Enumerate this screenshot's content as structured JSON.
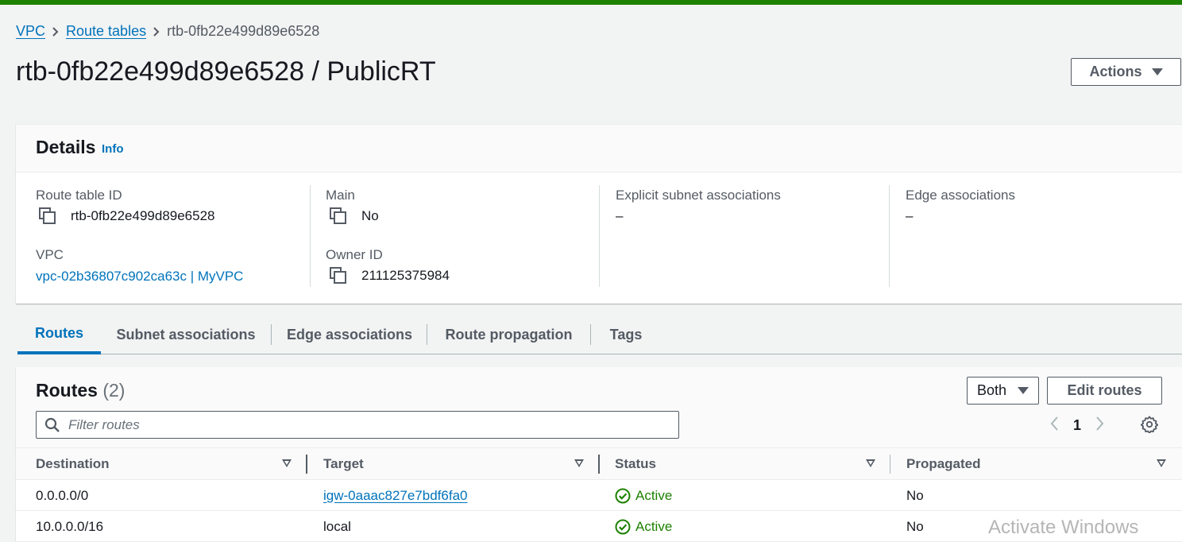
{
  "colors": {
    "accent": "#0073bb",
    "topbar": "#1d8102",
    "status_active": "#1d8102"
  },
  "breadcrumb": {
    "items": [
      {
        "label": "VPC"
      },
      {
        "label": "Route tables"
      }
    ],
    "current": "rtb-0fb22e499d89e6528"
  },
  "page": {
    "title": "rtb-0fb22e499d89e6528 / PublicRT",
    "actions_label": "Actions"
  },
  "details": {
    "title": "Details",
    "info_label": "Info",
    "route_table_id": {
      "label": "Route table ID",
      "value": "rtb-0fb22e499d89e6528"
    },
    "main": {
      "label": "Main",
      "value": "No"
    },
    "explicit_subnet": {
      "label": "Explicit subnet associations",
      "value": "–"
    },
    "edge": {
      "label": "Edge associations",
      "value": "–"
    },
    "vpc": {
      "label": "VPC",
      "value": "vpc-02b36807c902ca63c | MyVPC"
    },
    "owner_id": {
      "label": "Owner ID",
      "value": "211125375984"
    }
  },
  "tabs": [
    {
      "label": "Routes",
      "active": true
    },
    {
      "label": "Subnet associations"
    },
    {
      "label": "Edge associations"
    },
    {
      "label": "Route propagation"
    },
    {
      "label": "Tags"
    }
  ],
  "routes": {
    "title": "Routes",
    "count": "(2)",
    "filter_selected": "Both",
    "edit_label": "Edit routes",
    "filter_placeholder": "Filter routes",
    "page_number": "1",
    "columns": [
      "Destination",
      "Target",
      "Status",
      "Propagated"
    ],
    "rows": [
      {
        "destination": "0.0.0.0/0",
        "target": "igw-0aaac827e7bdf6fa0",
        "status": "Active",
        "propagated": "No"
      },
      {
        "destination": "10.0.0.0/16",
        "target": "local",
        "status": "Active",
        "propagated": "No"
      }
    ]
  },
  "watermark": "Activate Windows"
}
